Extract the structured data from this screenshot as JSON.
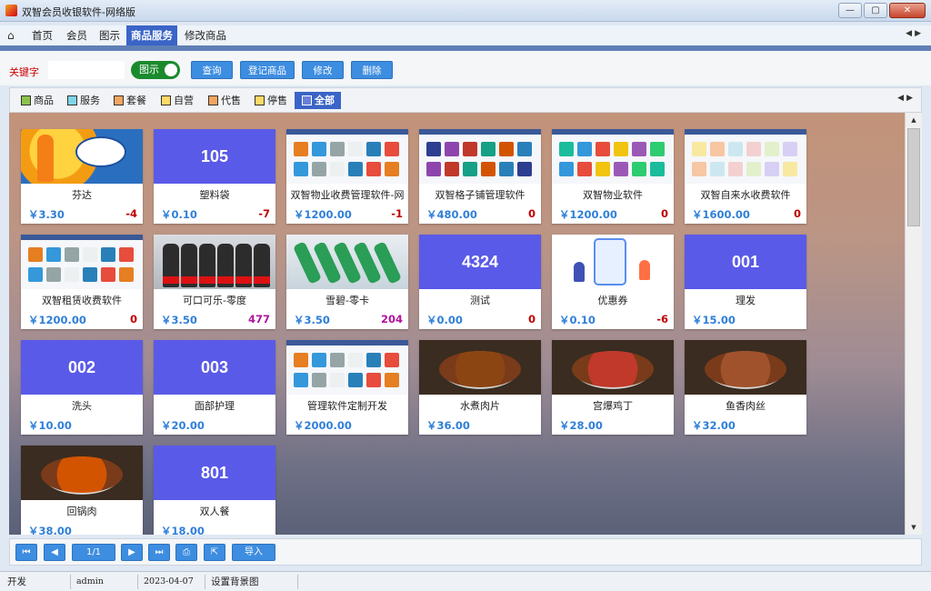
{
  "window": {
    "title": "双智会员收银软件-网络版"
  },
  "menu": {
    "tabs": [
      "首页",
      "会员",
      "图示",
      "商品服务",
      "修改商品"
    ],
    "active": "商品服务"
  },
  "toolbar": {
    "keyword_label": "关键字",
    "keyword_value": "",
    "toggle_label": "图示",
    "buttons": [
      "查询",
      "登记商品",
      "修改",
      "删除"
    ]
  },
  "categories": [
    {
      "label": "商品",
      "color": "#8bc34a"
    },
    {
      "label": "服务",
      "color": "#7fd4e8"
    },
    {
      "label": "套餐",
      "color": "#f4a460"
    },
    {
      "label": "自营",
      "color": "#ffd966"
    },
    {
      "label": "代售",
      "color": "#f4a460"
    },
    {
      "label": "停售",
      "color": "#ffd966"
    },
    {
      "label": "全部",
      "color": "#3a64c7",
      "active": true
    }
  ],
  "products": [
    {
      "name": "芬达",
      "price": "￥3.30",
      "stock": "-4",
      "image": "fanta-photo"
    },
    {
      "name": "塑料袋",
      "price": "￥0.10",
      "stock": "-7",
      "code": "105"
    },
    {
      "name": "双智物业收费管理软件-网",
      "price": "￥1200.00",
      "stock": "-1",
      "image": "software-screenshot"
    },
    {
      "name": "双智格子铺管理软件",
      "price": "￥480.00",
      "stock": "0",
      "image": "software-screenshot"
    },
    {
      "name": "双智物业软件",
      "price": "￥1200.00",
      "stock": "0",
      "image": "software-screenshot"
    },
    {
      "name": "双智自来水收费软件",
      "price": "￥1600.00",
      "stock": "0",
      "image": "software-screenshot"
    },
    {
      "name": "双智租赁收费软件",
      "price": "￥1200.00",
      "stock": "0",
      "image": "software-screenshot"
    },
    {
      "name": "可口可乐-零度",
      "price": "￥3.50",
      "stock": "477",
      "image": "coke-bottles-photo"
    },
    {
      "name": "雪碧-零卡",
      "price": "￥3.50",
      "stock": "204",
      "image": "sprite-bottles-photo"
    },
    {
      "name": "测试",
      "price": "￥0.00",
      "stock": "0",
      "code": "4324"
    },
    {
      "name": "优惠券",
      "price": "￥0.10",
      "stock": "-6",
      "image": "coupon-illustration"
    },
    {
      "name": "理发",
      "price": "￥15.00",
      "stock": "",
      "code": "001"
    },
    {
      "name": "洗头",
      "price": "￥10.00",
      "stock": "",
      "code": "002"
    },
    {
      "name": "面部护理",
      "price": "￥20.00",
      "stock": "",
      "code": "003"
    },
    {
      "name": "管理软件定制开发",
      "price": "￥2000.00",
      "stock": "",
      "image": "software-screenshot"
    },
    {
      "name": "水煮肉片",
      "price": "￥36.00",
      "stock": "",
      "image": "food-photo"
    },
    {
      "name": "宫爆鸡丁",
      "price": "￥28.00",
      "stock": "",
      "image": "food-photo"
    },
    {
      "name": "鱼香肉丝",
      "price": "￥32.00",
      "stock": "",
      "image": "food-photo"
    },
    {
      "name": "回锅肉",
      "price": "￥38.00",
      "stock": "",
      "image": "food-photo"
    },
    {
      "name": "双人餐",
      "price": "￥18.00",
      "stock": "",
      "code": "801"
    }
  ],
  "pagination": {
    "page": "1/1",
    "export_label": "导入"
  },
  "status": {
    "mode": "开发",
    "user": "admin",
    "date": "2023-04-07",
    "bg_link": "设置背景图"
  }
}
